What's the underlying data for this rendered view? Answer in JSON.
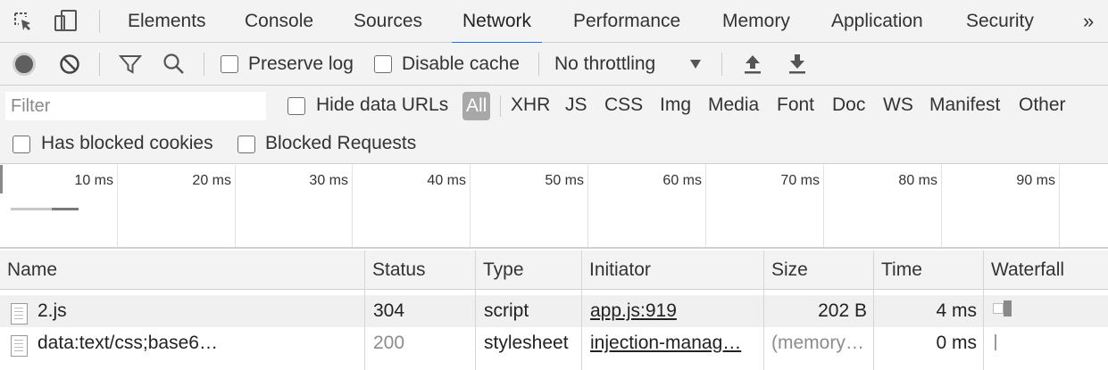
{
  "tabs": {
    "elements": "Elements",
    "console": "Console",
    "sources": "Sources",
    "network": "Network",
    "performance": "Performance",
    "memory": "Memory",
    "application": "Application",
    "security": "Security",
    "more": "»"
  },
  "toolbar": {
    "preserve_log": "Preserve log",
    "disable_cache": "Disable cache",
    "throttling": "No throttling"
  },
  "filter": {
    "placeholder": "Filter",
    "hide_data_urls": "Hide data URLs",
    "types": [
      "All",
      "XHR",
      "JS",
      "CSS",
      "Img",
      "Media",
      "Font",
      "Doc",
      "WS",
      "Manifest",
      "Other"
    ],
    "has_blocked_cookies": "Has blocked cookies",
    "blocked_requests": "Blocked Requests"
  },
  "overview": {
    "ticks": [
      "10 ms",
      "20 ms",
      "30 ms",
      "40 ms",
      "50 ms",
      "60 ms",
      "70 ms",
      "80 ms",
      "90 ms"
    ]
  },
  "table": {
    "headers": {
      "name": "Name",
      "status": "Status",
      "type": "Type",
      "initiator": "Initiator",
      "size": "Size",
      "time": "Time",
      "waterfall": "Waterfall"
    },
    "rows": [
      {
        "name": "2.js",
        "status": "304",
        "type": "script",
        "initiator": "app.js:919",
        "size": "202 B",
        "time": "4 ms"
      },
      {
        "name": "data:text/css;base6…",
        "status": "200",
        "type": "stylesheet",
        "initiator": "injection-manag…",
        "size": "(memory…",
        "time": "0 ms"
      }
    ]
  },
  "colors": {
    "active_tab_underline": "#1a73e8",
    "all_filter_bg": "#a8a8a8",
    "panel_bg": "#f3f3f3"
  }
}
